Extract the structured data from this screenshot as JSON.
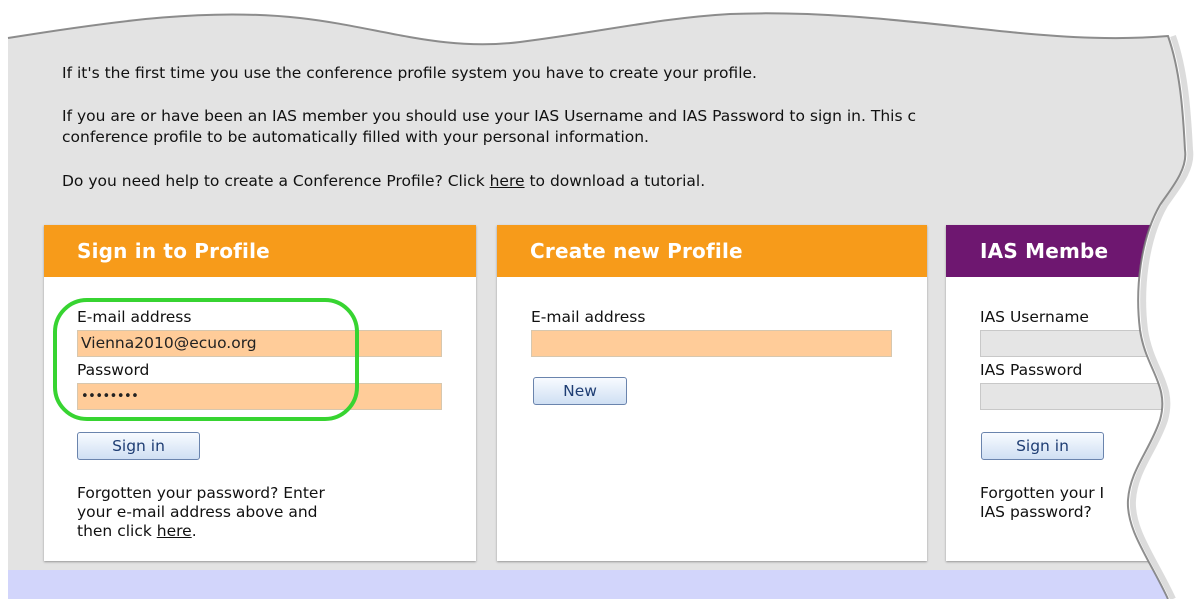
{
  "intro": {
    "line1": "If it's the first time you use the conference profile system you have to create your profile.",
    "line2a": "If you are or have been an IAS member you should use your IAS Username and IAS Password to sign in. This c",
    "line2b": "conference profile to be automatically filled with your personal information.",
    "line3_before": "Do you need help to create a Conference Profile? Click ",
    "line3_link": "here",
    "line3_after": " to download a tutorial."
  },
  "signin_panel": {
    "title": "Sign in to Profile",
    "email_label": "E-mail address",
    "email_value": "Vienna2010@ecuo.org",
    "password_label": "Password",
    "password_mask": "••••••••",
    "button": "Sign in",
    "help_line1": "Forgotten your password? Enter",
    "help_line2": "your e-mail address above and",
    "help_line3_before": "then click ",
    "help_line3_link": "here",
    "help_line3_after": "."
  },
  "create_panel": {
    "title": "Create new Profile",
    "email_label": "E-mail address",
    "email_value": "",
    "button": "New"
  },
  "ias_panel": {
    "title": "IAS Membe",
    "username_label": "IAS Username",
    "password_label": "IAS Password",
    "button": "Sign in",
    "help_line1": "Forgotten your I",
    "help_line2": "IAS password?"
  },
  "colors": {
    "panel_header_orange": "#f79b1a",
    "panel_header_purple": "#6e1770",
    "input_orange": "#ffcc99",
    "highlight_green": "#37d431",
    "page_gray": "#e3e3e3",
    "footer_band": "#d2d5fb"
  }
}
